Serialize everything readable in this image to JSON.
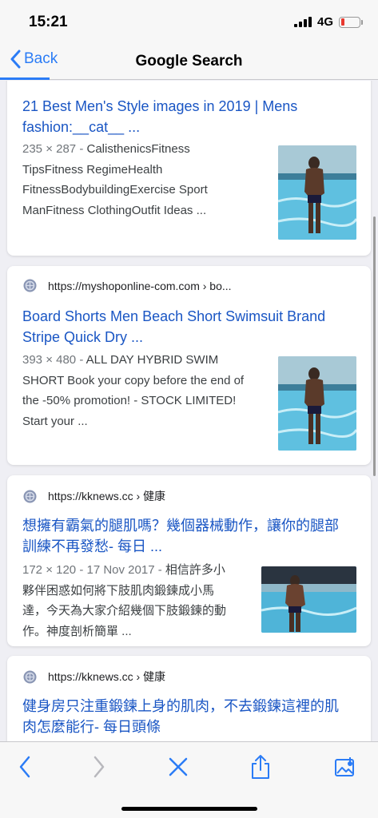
{
  "status": {
    "time": "15:21",
    "network": "4G",
    "battery_level": 0.2,
    "battery_color": "#e8392f"
  },
  "nav": {
    "back_label": "Back",
    "title": "Google Search",
    "accent": "#2b7cf6"
  },
  "results": [
    {
      "title": "21 Best Men's Style images in 2019 | Mens fashion:__cat__ ...",
      "meta": "235 × 287 - ",
      "snippet": "CalisthenicsFitness TipsFitness RegimeHealth FitnessBodybuildingExercise Sport ManFitness ClothingOutfit Ideas ...",
      "snippet_lines": [
        "CalisthenicsFitness",
        "TipsFitness RegimeHealth",
        "FitnessBodybuildingExercise Sport",
        "ManFitness ClothingOutfit Ideas ..."
      ],
      "thumb_icon": "pool-man-photo"
    },
    {
      "source": "https://myshoponline-com.com › bo...",
      "title": "Board Shorts Men Beach Short Swimsuit Brand Stripe Quick Dry ...",
      "meta": "393 × 480 - ",
      "snippet": "ALL DAY HYBRID SWIM SHORT Book your copy before the end of the -50% promotion! - STOCK LIMITED! Start your ...",
      "snippet_lines": [
        "ALL DAY HYBRID SWIM",
        "SHORT Book your copy before the end of",
        "the -50% promotion! - STOCK LIMITED!",
        "Start your ..."
      ],
      "thumb_icon": "pool-man-photo"
    },
    {
      "source": "https://kknews.cc › 健康",
      "title": "想擁有霸氣的腿肌嗎？幾個器械動作，讓你的腿部訓練不再發愁- 每日 ...",
      "meta": "172 × 120 - 17 Nov 2017 - ",
      "snippet": "相信許多小夥伴困惑如何將下肢肌肉鍛鍊成小馬達，今天為大家介紹幾個下肢鍛鍊的動作。神度剖析簡單 ...",
      "snippet_lines": [
        "相信許多小",
        "夥伴困惑如何將下肢肌肉鍛鍊成小馬",
        "達，今天為大家介紹幾個下肢鍛鍊的動",
        "作。神度剖析簡單 ..."
      ],
      "thumb_icon": "pool-man-photo"
    },
    {
      "source": "https://kknews.cc › 健康",
      "title": "健身房只注重鍛鍊上身的肌肉，不去鍛鍊這裡的肌肉怎麼能行- 每日頭條"
    }
  ],
  "toolbar": {
    "items": [
      "back-icon",
      "forward-icon",
      "close-icon",
      "share-icon",
      "save-image-icon"
    ]
  }
}
